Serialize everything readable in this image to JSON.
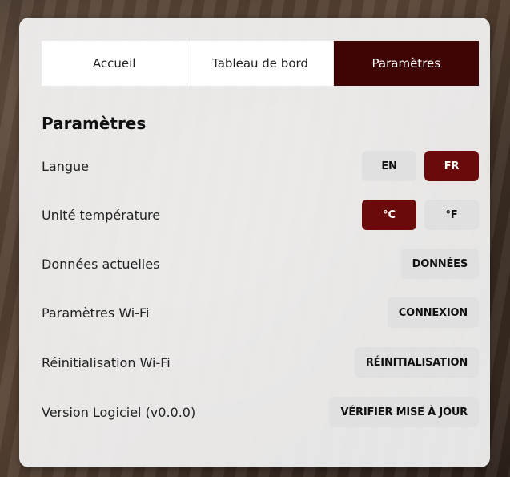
{
  "tabs": [
    {
      "label": "Accueil",
      "active": false
    },
    {
      "label": "Tableau de bord",
      "active": false
    },
    {
      "label": "Paramètres",
      "active": true
    }
  ],
  "settings": {
    "title": "Paramètres",
    "language": {
      "label": "Langue",
      "options": [
        "EN",
        "FR"
      ],
      "selected": "FR"
    },
    "temperature": {
      "label": "Unité température",
      "options": [
        "°C",
        "°F"
      ],
      "selected": "°C"
    },
    "current_data": {
      "label": "Données actuelles",
      "button": "DONNÉES"
    },
    "wifi_settings": {
      "label": "Paramètres Wi-Fi",
      "button": "CONNEXION"
    },
    "wifi_reset": {
      "label": "Réinitialisation Wi-Fi",
      "button": "RÉINITIALISATION"
    },
    "firmware": {
      "label": "Version Logiciel (v0.0.0)",
      "button": "VÉRIFIER MISE À JOUR"
    }
  },
  "colors": {
    "accent": "#6b0a0a",
    "tab_active": "#3f0504"
  }
}
